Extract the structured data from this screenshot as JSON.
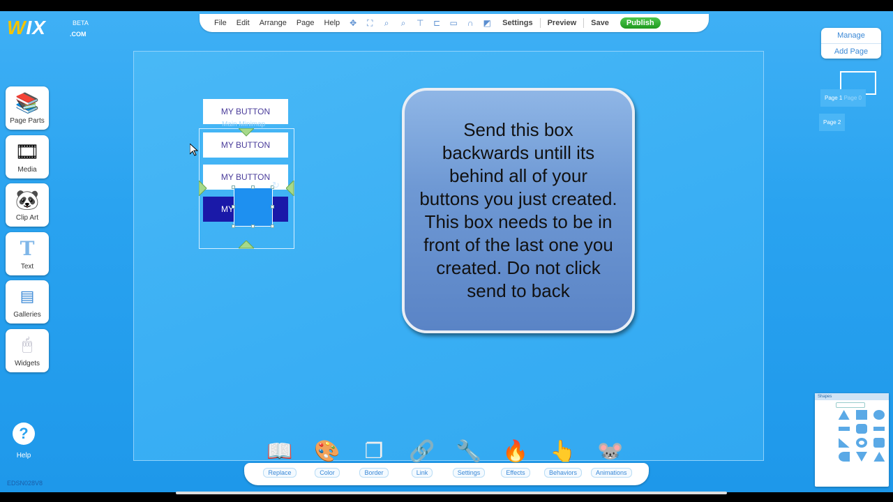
{
  "logo": {
    "wordmark": "WIX",
    "beta": "BETA",
    "com": ".COM"
  },
  "toolbar": {
    "menu": [
      "File",
      "Edit",
      "Arrange",
      "Page",
      "Help"
    ],
    "settings": "Settings",
    "preview": "Preview",
    "save": "Save",
    "publish": "Publish"
  },
  "pages": {
    "manage": "Manage",
    "add_page": "Add Page",
    "tab1": "Page 1",
    "tab_ghost": "Page 0",
    "tab2": "Page 2"
  },
  "left_tools": [
    {
      "label": "Page Parts"
    },
    {
      "label": "Media"
    },
    {
      "label": "Clip Art"
    },
    {
      "label": "Text"
    },
    {
      "label": "Galleries"
    },
    {
      "label": "Widgets"
    }
  ],
  "help": {
    "label": "Help"
  },
  "footer_code": "EDSN028V8",
  "canvas": {
    "buttons": [
      "MY BUTTON",
      "MY BUTTON",
      "MY BUTTON",
      "MY"
    ],
    "ghost_text": "Main Minimap"
  },
  "callout": {
    "text": "Send this box backwards untill its behind all of your buttons you just created. This box needs to be in front of the last one you created. Do not click send to back"
  },
  "bottom_tools": [
    "Replace",
    "Color",
    "Border",
    "Link",
    "Settings",
    "Effects",
    "Behaviors",
    "Animations"
  ],
  "shapes_panel": {
    "title": "Shapes"
  },
  "colors": {
    "background": "#2aa3f0",
    "publish": "#2aa42a",
    "button_dark": "#1a19a8",
    "callout": "#6f99d4"
  }
}
